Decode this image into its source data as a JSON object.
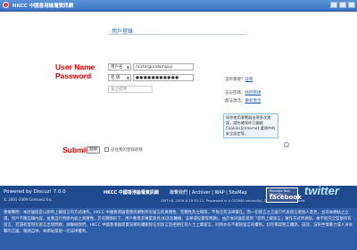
{
  "window": {
    "title": "HKCC 中國香港論壇資訊網"
  },
  "login": {
    "heading": "用戶登錄",
    "username_label": "User Name",
    "password_label": "Password",
    "username_mode": "用戶名",
    "username_value": "mistergundamguy",
    "password_mode": "密 碼",
    "password_value": "●●●●●●●●●●●",
    "security_question": "安全提問",
    "not_registered": "沒有帳號？",
    "register_link": "註冊",
    "forgot_prefix": "忘記密碼，",
    "forgot_link": "找回密碼",
    "no_activation_prefix": "無法激活，",
    "no_activation_link": "重新激活",
    "notice_text": "如你使用瀏覽器出現多次錯誤，請先確保你已開啟Cookies及Internet 選項中的安全設定等。",
    "submit_label": "Submit",
    "submit_button": "登錄",
    "remember_label": "記住我的登錄狀態"
  },
  "footer": {
    "powered_by": "Powered by Discuz! 7.0.0",
    "copyright": "© 2001-2009 Comsenz Inc.",
    "site_name": "HKCC 中國香港論壇資訊網",
    "links": [
      "聯繫我們",
      "Archiver",
      "WAP",
      "SiteMap"
    ],
    "stats": "GMT+8, 2009-6-19 01:11, Processed in 0.022080 second(s), 5 queries, Gzip enabled.",
    "facebook_line1": "Promote Your Page Too",
    "facebook_label": "facebook",
    "twitter_label": "twitter",
    "disclaimer": "重要聲明：本討論區是以即時上載留言的方式運作，HKCC 中國香港論壇資訊網對所有留言的真實性、完整性及立場等，不負任何法律責任。而一切留言之言論只代表留言者個人意見，並非本網站之立場，用戶不應信賴內容，並應自行判斷內容之真實性。於有關情形下，用戶應尋求專業意見(如涉及醫療、法律或投資等問題)。由於本討論區受到「即時上載留言」運作方式所規限，故不能完全監察所有留言，若讀者發現有留言出現問題，請聯絡我們。HKCC 中國香港論壇資訊網有權刪除任何留言及拒絕任何人士上載留言，同時亦有不刪除留言的權利。切勿撰寫粗言穢語、誹謗、渲染色情暴力或人身攻擊的言論，敬請自律。本網站保留一切法律權利。"
  }
}
